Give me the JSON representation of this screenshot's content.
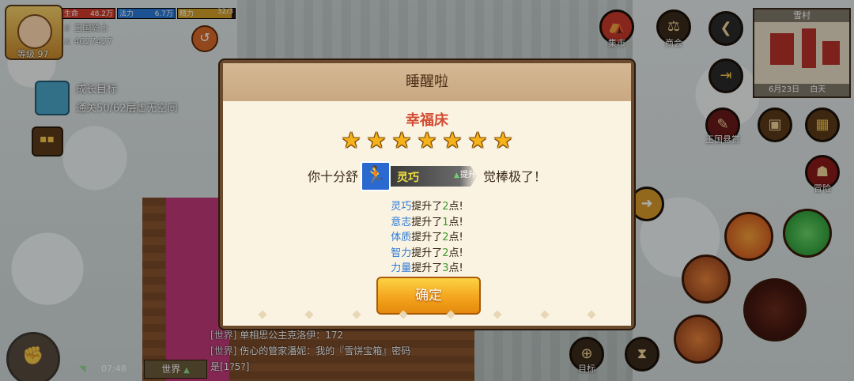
{
  "hud": {
    "level": "等级 97",
    "title": "王国骑士",
    "power": "4027427",
    "bars": [
      {
        "label": "生命",
        "value": "48.2万",
        "color": "#d23a2a",
        "fill": 1.0
      },
      {
        "label": "法力",
        "value": "6.7万",
        "color": "#2a7ad8",
        "fill": 1.0
      },
      {
        "label": "精力",
        "value": "32/3",
        "color": "#d2a02a",
        "fill": 0.95
      }
    ],
    "growth_title": "成长目标",
    "growth_desc": "通关50/62层虚无空间"
  },
  "right_hud": {
    "market": "集市",
    "shop": "商会",
    "bounty": "王国悬赏",
    "adventure": "冒险",
    "target": "目标"
  },
  "minimap": {
    "title": "雪村",
    "date": "6月23日",
    "time": "白天"
  },
  "chat": {
    "lines": [
      {
        "tag": "[世界]",
        "text": "单相思公主克洛伊：172"
      },
      {
        "tag": "[世界]",
        "text": "伤心的管家潘妮：我的『雪饼宝箱』密码"
      },
      {
        "tag": "",
        "text": "是[1?5?]"
      }
    ],
    "channel": "世界",
    "channel_arrow": "▲",
    "clock": "07:48"
  },
  "dialog": {
    "header": "睡醒啦",
    "bed_name": "幸福床",
    "star_count": 7,
    "message_before": "你十分舒",
    "message_after": "觉棒极了！",
    "buff": {
      "name": "灵巧",
      "up_label": "提升"
    },
    "stats": [
      {
        "name": "灵巧",
        "mid": "提升了",
        "num": "2",
        "end": "点!"
      },
      {
        "name": "意志",
        "mid": "提升了",
        "num": "1",
        "end": "点!"
      },
      {
        "name": "体质",
        "mid": "提升了",
        "num": "2",
        "end": "点!"
      },
      {
        "name": "智力",
        "mid": "提升了",
        "num": "2",
        "end": "点!"
      },
      {
        "name": "力量",
        "mid": "提升了",
        "num": "3",
        "end": "点!"
      }
    ],
    "confirm": "确定"
  }
}
